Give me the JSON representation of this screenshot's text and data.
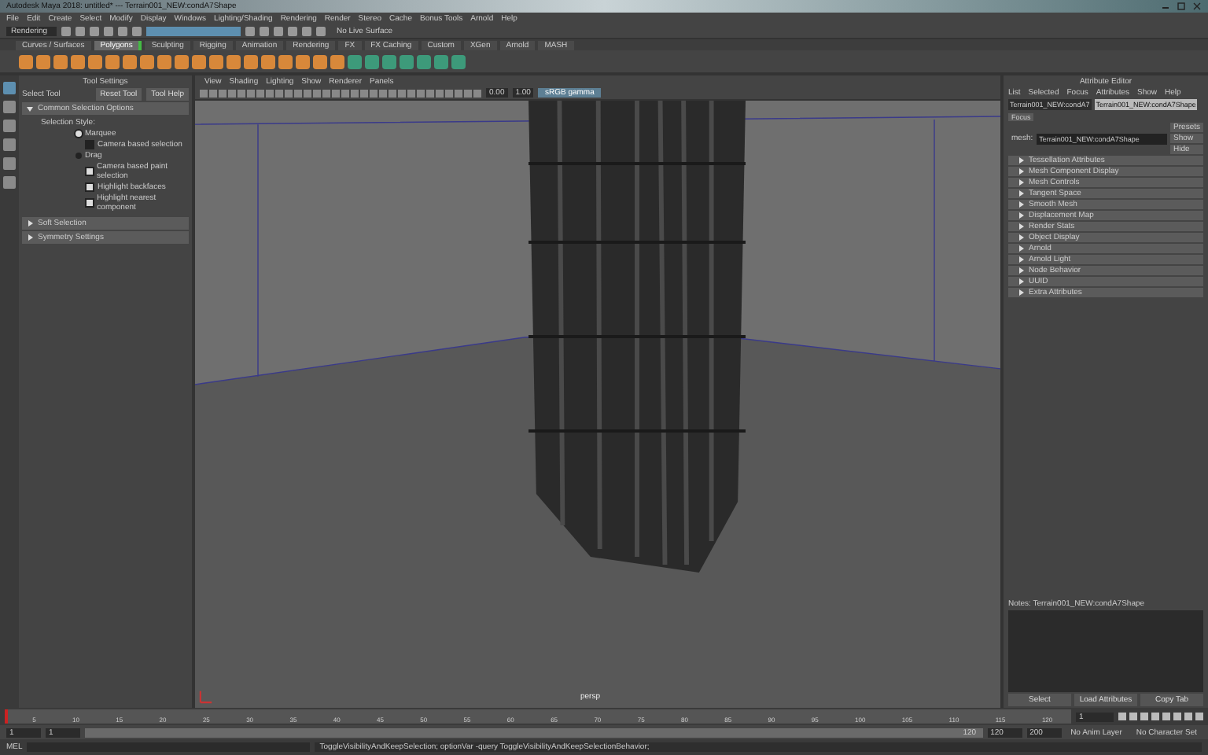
{
  "window": {
    "title": "Autodesk Maya 2018: untitled* --- Terrain001_NEW:condA7Shape"
  },
  "menu": [
    "File",
    "Edit",
    "Create",
    "Select",
    "Modify",
    "Display",
    "Windows",
    "Lighting/Shading",
    "Rendering",
    "Render",
    "Stereo",
    "Cache",
    "Bonus Tools",
    "Arnold",
    "Help"
  ],
  "status_line": {
    "mode": "Rendering",
    "live_surface": "No Live Surface"
  },
  "shelf_tabs": [
    {
      "label": "Curves / Surfaces",
      "selected": false
    },
    {
      "label": "Polygons",
      "selected": true
    },
    {
      "label": "Sculpting",
      "selected": false
    },
    {
      "label": "Rigging",
      "selected": false
    },
    {
      "label": "Animation",
      "selected": false
    },
    {
      "label": "Rendering",
      "selected": false
    },
    {
      "label": "FX",
      "selected": false
    },
    {
      "label": "FX Caching",
      "selected": false
    },
    {
      "label": "Custom",
      "selected": false
    },
    {
      "label": "XGen",
      "selected": false
    },
    {
      "label": "Arnold",
      "selected": false
    },
    {
      "label": "MASH",
      "selected": false
    }
  ],
  "shelf_icons": [
    {
      "kind": "poly"
    },
    {
      "kind": "poly"
    },
    {
      "kind": "poly"
    },
    {
      "kind": "poly"
    },
    {
      "kind": "poly"
    },
    {
      "kind": "poly"
    },
    {
      "kind": "poly"
    },
    {
      "kind": "poly"
    },
    {
      "kind": "poly"
    },
    {
      "kind": "poly"
    },
    {
      "kind": "poly"
    },
    {
      "kind": "poly"
    },
    {
      "kind": "poly"
    },
    {
      "kind": "poly"
    },
    {
      "kind": "poly"
    },
    {
      "kind": "poly"
    },
    {
      "kind": "poly"
    },
    {
      "kind": "poly"
    },
    {
      "kind": "poly"
    },
    {
      "kind": "uv"
    },
    {
      "kind": "uv"
    },
    {
      "kind": "uv"
    },
    {
      "kind": "uv"
    },
    {
      "kind": "uv"
    },
    {
      "kind": "uv"
    },
    {
      "kind": "uv"
    }
  ],
  "tool_settings": {
    "title": "Tool Settings",
    "tool": "Select Tool",
    "buttons": [
      "Reset Tool",
      "Tool Help"
    ],
    "section": "Common Selection Options",
    "style_label": "Selection Style:",
    "options": [
      {
        "kind": "radio",
        "label": "Marquee",
        "checked": true
      },
      {
        "kind": "check",
        "label": "Camera based selection",
        "checked": false
      },
      {
        "kind": "radio",
        "label": "Drag",
        "checked": false
      },
      {
        "kind": "check",
        "label": "Camera based paint selection",
        "checked": true
      },
      {
        "kind": "check",
        "label": "Highlight backfaces",
        "checked": true
      },
      {
        "kind": "check",
        "label": "Highlight nearest component",
        "checked": true
      }
    ],
    "collapsed_sections": [
      "Soft Selection",
      "Symmetry Settings"
    ]
  },
  "viewport": {
    "menu": [
      "View",
      "Shading",
      "Lighting",
      "Show",
      "Renderer",
      "Panels"
    ],
    "exposure": "0.00",
    "gamma": "1.00",
    "color_space": "sRGB gamma",
    "camera": "persp"
  },
  "attribute_editor": {
    "title": "Attribute Editor",
    "menu": [
      "List",
      "Selected",
      "Focus",
      "Attributes",
      "Show",
      "Help"
    ],
    "tabs": [
      {
        "label": "Terrain001_NEW:condA7",
        "selected": false
      },
      {
        "label": "Terrain001_NEW:condA7Shape",
        "selected": true
      }
    ],
    "mesh_label": "mesh:",
    "mesh_value": "Terrain001_NEW:condA7Shape",
    "side_buttons": [
      "Focus",
      "Presets",
      "Show",
      "Hide"
    ],
    "sections": [
      "Tessellation Attributes",
      "Mesh Component Display",
      "Mesh Controls",
      "Tangent Space",
      "Smooth Mesh",
      "Displacement Map",
      "Render Stats",
      "Object Display",
      "Arnold",
      "Arnold Light",
      "Node Behavior",
      "UUID",
      "Extra Attributes"
    ],
    "notes": "Notes:  Terrain001_NEW:condA7Shape",
    "buttons": [
      "Select",
      "Load Attributes",
      "Copy Tab"
    ]
  },
  "time_slider": {
    "ticks": [
      "5",
      "10",
      "15",
      "20",
      "25",
      "30",
      "35",
      "40",
      "45",
      "50",
      "55",
      "60",
      "65",
      "70",
      "75",
      "80",
      "85",
      "90",
      "95",
      "100",
      "105",
      "110",
      "115",
      "120"
    ],
    "current": "1",
    "level": 0.0
  },
  "range": {
    "level": 1.0,
    "start": "1",
    "start_inner": "1",
    "end_inner": "120",
    "end": "120",
    "end_outer": "200",
    "anim_layer": "No Anim Layer",
    "character_set": "No Character Set"
  },
  "command_line": {
    "language": "MEL",
    "help": "ToggleVisibilityAndKeepSelection; optionVar -query ToggleVisibilityAndKeepSelectionBehavior;"
  }
}
